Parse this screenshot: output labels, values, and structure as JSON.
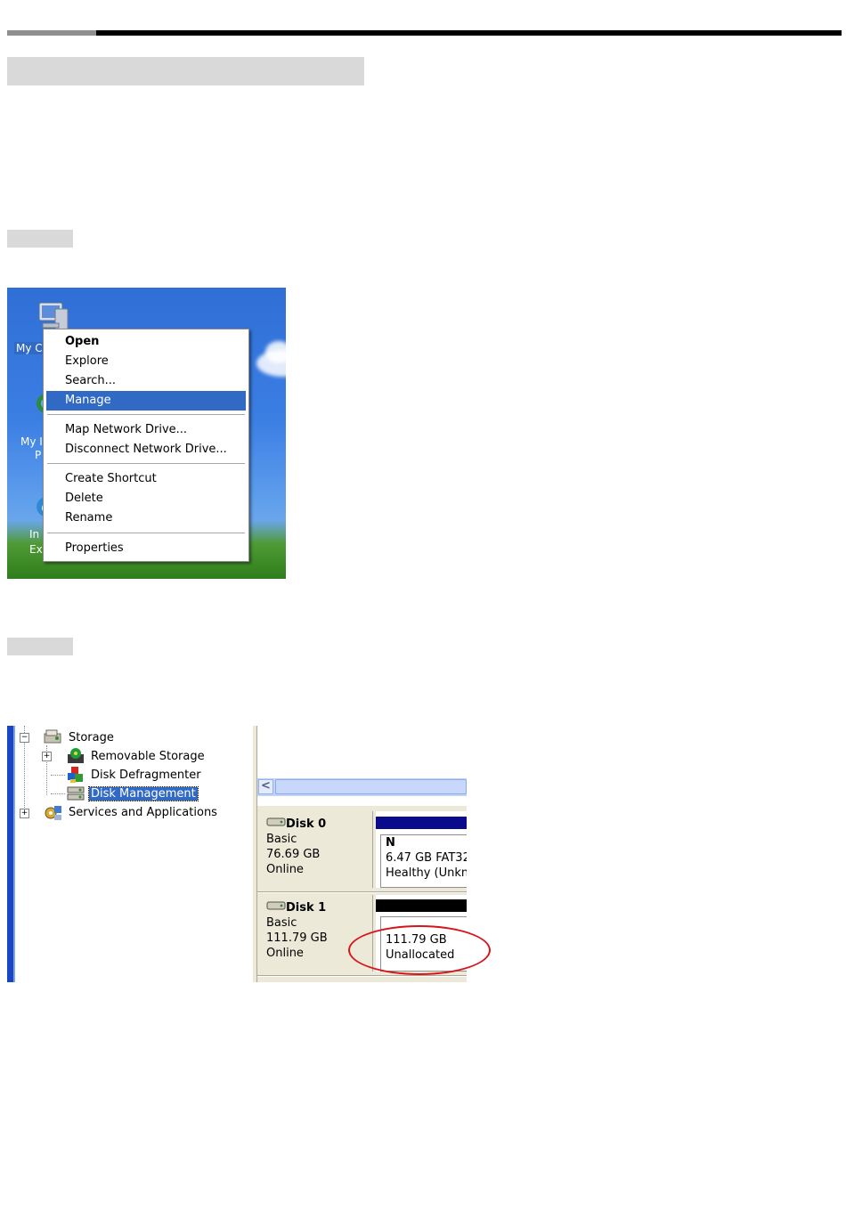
{
  "colors": {
    "menu_highlight": "#316ac5",
    "disk0_bar": "#0a0a8c",
    "disk1_bar": "#000000",
    "annotation_circle": "#d8141a",
    "doc_rule": "#000000"
  },
  "desktop": {
    "icons": [
      {
        "name": "my-computer-icon",
        "label": "My C"
      },
      {
        "name": "network-places-icon",
        "label": "My I",
        "label2": "P"
      },
      {
        "name": "internet-explorer-icon",
        "label": "In",
        "label2": "Ex"
      }
    ]
  },
  "context_menu": {
    "items": [
      {
        "label": "Open",
        "bold": true
      },
      {
        "label": "Explore"
      },
      {
        "label": "Search..."
      },
      {
        "label": "Manage",
        "highlighted": true
      },
      {
        "label": "Map Network Drive..."
      },
      {
        "label": "Disconnect Network Drive..."
      },
      {
        "label": "Create Shortcut"
      },
      {
        "label": "Delete"
      },
      {
        "label": "Rename"
      },
      {
        "label": "Properties"
      }
    ]
  },
  "tree": {
    "items": [
      {
        "label": "Storage",
        "expander": "−",
        "icon": "storage-icon"
      },
      {
        "label": "Removable Storage",
        "expander": "+",
        "icon": "removable-storage-icon"
      },
      {
        "label": "Disk Defragmenter",
        "icon": "disk-defragmenter-icon"
      },
      {
        "label": "Disk Management",
        "icon": "disk-management-icon",
        "selected": true
      },
      {
        "label": "Services and Applications",
        "expander": "+",
        "icon": "services-icon"
      }
    ]
  },
  "scrollbar": {
    "left_arrow": "<"
  },
  "disks": [
    {
      "name": "Disk 0",
      "type": "Basic",
      "size": "76.69 GB",
      "status": "Online",
      "volume": {
        "line1": "N",
        "line2": "6.47 GB FAT32",
        "line3": "Healthy (Unkn"
      }
    },
    {
      "name": "Disk 1",
      "type": "Basic",
      "size": "111.79 GB",
      "status": "Online",
      "volume": {
        "line1": "111.79 GB",
        "line2": "Unallocated"
      }
    }
  ]
}
